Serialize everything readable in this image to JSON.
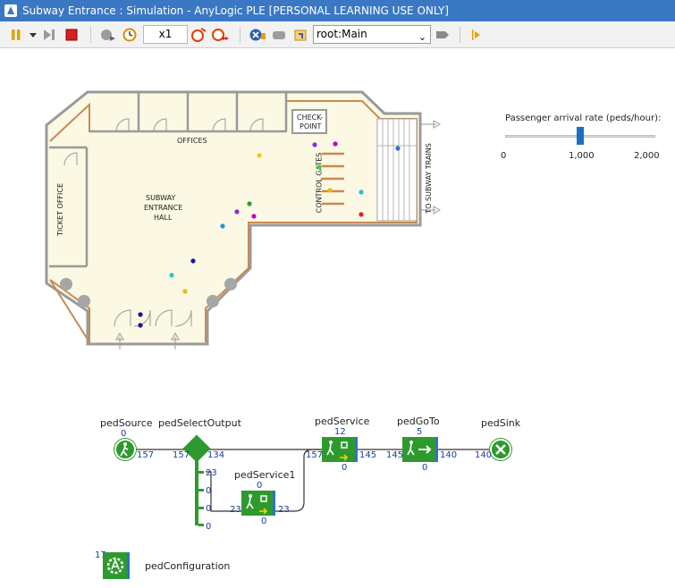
{
  "window": {
    "title": "Subway Entrance : Simulation - AnyLogic PLE [PERSONAL LEARNING USE ONLY]"
  },
  "toolbar": {
    "speed": "x1",
    "navigation_value": "root:Main",
    "icons": [
      "pause-icon",
      "dropdown-icon",
      "step-icon",
      "stop-icon",
      "run-until-icon",
      "realtime-icon",
      "slow-down-icon",
      "speed-up-icon",
      "experiment-icon",
      "back-icon",
      "home-icon",
      "navigation-dropdown",
      "camera-icon",
      "developer-panel-icon"
    ]
  },
  "layout_labels": {
    "offices": "OFFICES",
    "checkpoint_line1": "CHECK-",
    "checkpoint_line2": "POINT",
    "hall_line1": "SUBWAY",
    "hall_line2": "ENTRANCE",
    "hall_line3": "HALL",
    "ticket_office": "TICKET OFFICE",
    "control_gates": "CONTROL GATES",
    "to_trains": "TO SUBWAY TRAINS"
  },
  "slider": {
    "title": "Passenger arrival rate (peds/hour):",
    "value": 1000,
    "min": 0,
    "max": 2000,
    "tick_labels": [
      "0",
      "1,000",
      "2,000"
    ]
  },
  "pedestrians": [
    {
      "color": "#8a2be2"
    },
    {
      "color": "#c000c0"
    },
    {
      "color": "#44cc44"
    },
    {
      "color": "#f5c518"
    },
    {
      "color": "#1a9ad6"
    },
    {
      "color": "#e02020"
    },
    {
      "color": "#f2b400"
    },
    {
      "color": "#2d9e2d"
    },
    {
      "color": "#c000c0"
    },
    {
      "color": "#8e2ebd"
    },
    {
      "color": "#2e6fd6"
    },
    {
      "color": "#1515a0"
    },
    {
      "color": "#2ec6c6"
    },
    {
      "color": "#e6c000"
    },
    {
      "color": "#1515a0"
    },
    {
      "color": "#1515a0"
    },
    {
      "color": "#22c1d6"
    }
  ],
  "blocks": {
    "pedSource": {
      "name": "pedSource",
      "count_top": "0",
      "out": "157"
    },
    "pedSelectOutput": {
      "name": "pedSelectOutput",
      "in": "157",
      "out1": "134",
      "out2": "23",
      "out3": "0",
      "out4": "0",
      "out5": "0"
    },
    "pedService1": {
      "name": "pedService1",
      "count_top": "0",
      "in": "23",
      "out": "23",
      "count_bottom": "0"
    },
    "pedService": {
      "name": "pedService",
      "count_top": "12",
      "in": "157",
      "out": "145",
      "count_bottom": "0"
    },
    "pedGoTo": {
      "name": "pedGoTo",
      "count_top": "5",
      "in": "145",
      "out": "140",
      "count_bottom": "0"
    },
    "pedSink": {
      "name": "pedSink",
      "in": "140"
    },
    "pedConfiguration": {
      "name": "pedConfiguration",
      "count": "17"
    }
  },
  "colors": {
    "title_bar": "#3b78c4",
    "block_green": "#2e9a2e",
    "wall_orange": "#c98a50",
    "floor": "#fbf8e4",
    "count_blue": "#1a3aa0",
    "slider_thumb": "#1c6fbf"
  }
}
